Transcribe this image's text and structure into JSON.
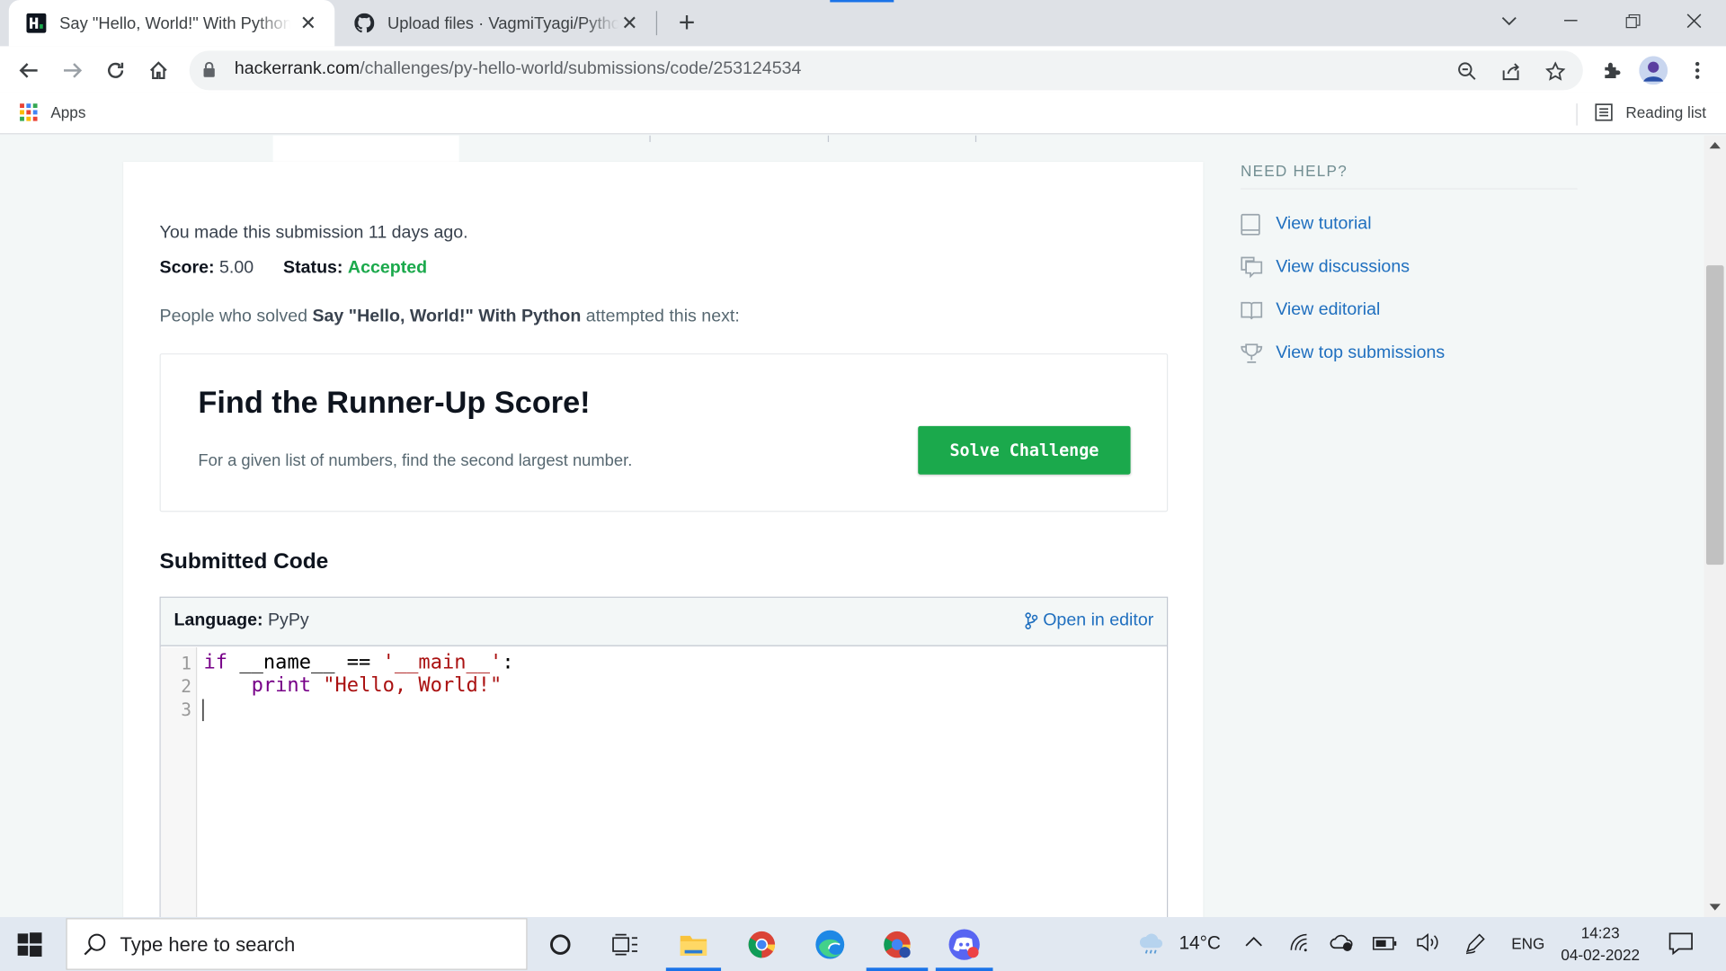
{
  "browser": {
    "tabs": [
      {
        "title": "Say \"Hello, World!\" With Python | HackerRank",
        "favicon": "hackerrank-icon",
        "active": true
      },
      {
        "title": "Upload files · VagmiTyagi/Python",
        "favicon": "github-icon",
        "active": false
      }
    ],
    "url_domain": "hackerrank.com",
    "url_path": "/challenges/py-hello-world/submissions/code/253124534",
    "bookmarks": {
      "apps_label": "Apps",
      "reading_list_label": "Reading list"
    }
  },
  "submission": {
    "message": "You made this submission 11 days ago.",
    "score_label": "Score:",
    "score_value": "5.00",
    "status_label": "Status:",
    "status_value": "Accepted",
    "people_prefix": "People who solved ",
    "people_challenge": "Say \"Hello, World!\" With Python",
    "people_suffix": " attempted this next:"
  },
  "next_challenge": {
    "title": "Find the Runner-Up Score!",
    "description": "For a given list of numbers, find the second largest number.",
    "button_label": "Solve Challenge"
  },
  "submitted_code": {
    "heading": "Submitted Code",
    "language_label": "Language:",
    "language_value": "PyPy",
    "open_editor_label": "Open in editor",
    "line_numbers": [
      "1",
      "2",
      "3"
    ],
    "lines": [
      "if __name__ == '__main__':",
      "    print \"Hello, World!\"",
      ""
    ]
  },
  "help": {
    "title": "NEED HELP?",
    "items": [
      {
        "label": "View tutorial",
        "icon": "tutorial-icon"
      },
      {
        "label": "View discussions",
        "icon": "discussions-icon"
      },
      {
        "label": "View editorial",
        "icon": "editorial-icon"
      },
      {
        "label": "View top submissions",
        "icon": "trophy-icon"
      }
    ]
  },
  "taskbar": {
    "search_placeholder": "Type here to search",
    "temperature": "14°C",
    "language": "ENG",
    "time": "14:23",
    "date": "04-02-2022"
  },
  "colors": {
    "accent_green": "#1ba94c",
    "link_blue": "#1f6fbf",
    "chrome_blue": "#1a73e8"
  }
}
